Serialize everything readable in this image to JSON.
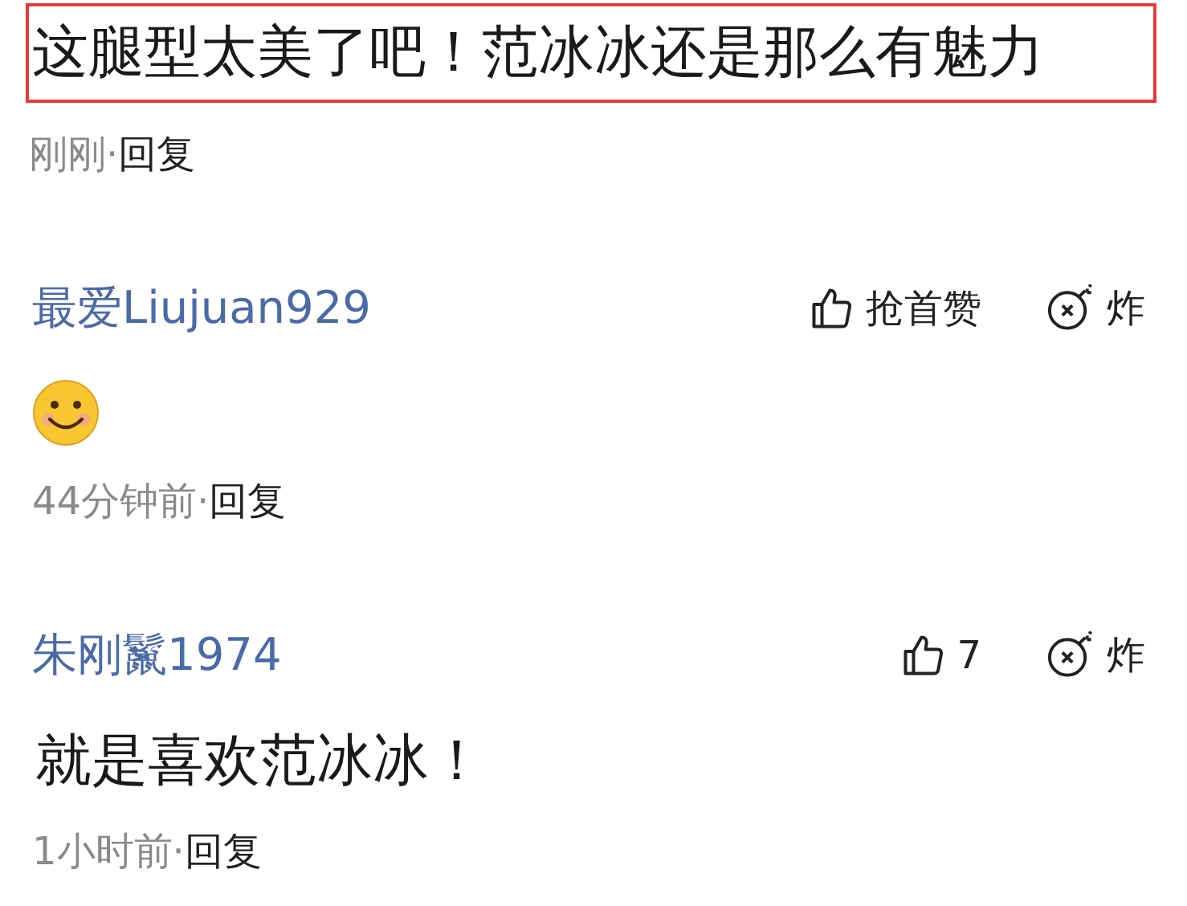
{
  "comments": [
    {
      "kind": "text",
      "text": "这腿型太美了吧！范冰冰还是那么有魅力",
      "highlighted": true,
      "time": "刚刚·",
      "reply": "回复"
    },
    {
      "kind": "emoji",
      "author": "最爱Liujuan929",
      "like": "抢首赞",
      "bomb": "炸",
      "time": "44分钟前·",
      "reply": "回复"
    },
    {
      "kind": "text",
      "author": "朱刚鬣1974",
      "like": "7",
      "bomb": "炸",
      "text": "就是喜欢范冰冰！",
      "highlighted": false,
      "time": "1小时前·",
      "reply": "回复"
    }
  ]
}
